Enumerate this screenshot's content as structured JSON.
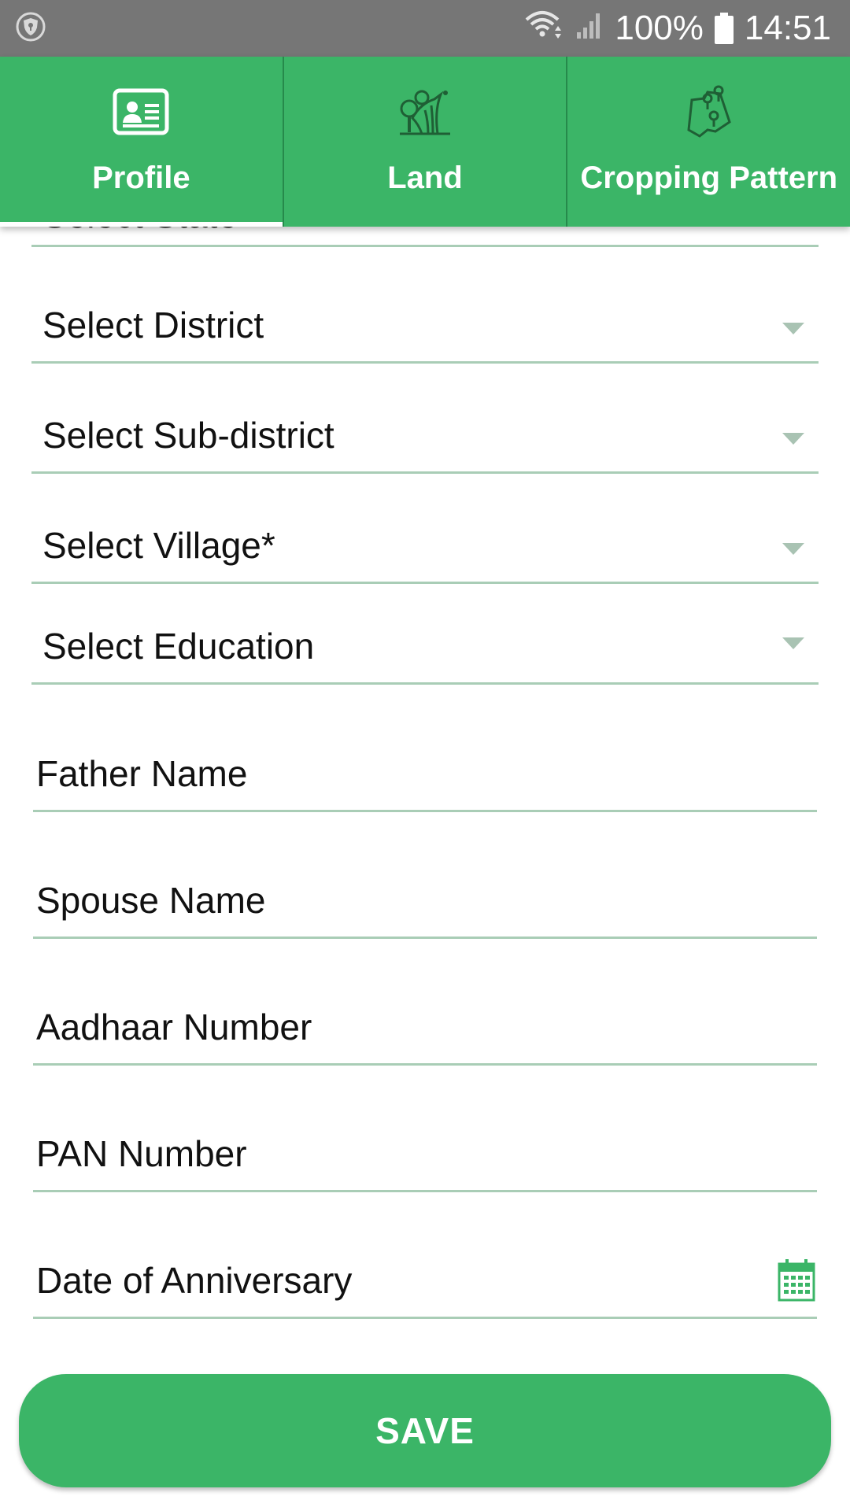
{
  "status_bar": {
    "battery": "100%",
    "time": "14:51"
  },
  "tabs": [
    {
      "label": "Profile",
      "icon": "id-card-icon",
      "active": true
    },
    {
      "label": "Land",
      "icon": "land-field-icon",
      "active": false
    },
    {
      "label": "Cropping Pattern",
      "icon": "map-pin-plots-icon",
      "active": false
    }
  ],
  "form": {
    "dropdowns": [
      {
        "label": "Select State"
      },
      {
        "label": "Select District"
      },
      {
        "label": "Select Sub-district"
      },
      {
        "label": "Select Village*"
      },
      {
        "label": "Select Education"
      }
    ],
    "inputs": [
      {
        "placeholder": "Father Name"
      },
      {
        "placeholder": "Spouse Name"
      },
      {
        "placeholder": "Aadhaar Number"
      },
      {
        "placeholder": "PAN Number"
      },
      {
        "placeholder": "Date of Anniversary"
      }
    ]
  },
  "save_label": "SAVE",
  "colors": {
    "accent": "#3bb567",
    "status_bar": "#767676",
    "underline": "#a9cdb6"
  }
}
